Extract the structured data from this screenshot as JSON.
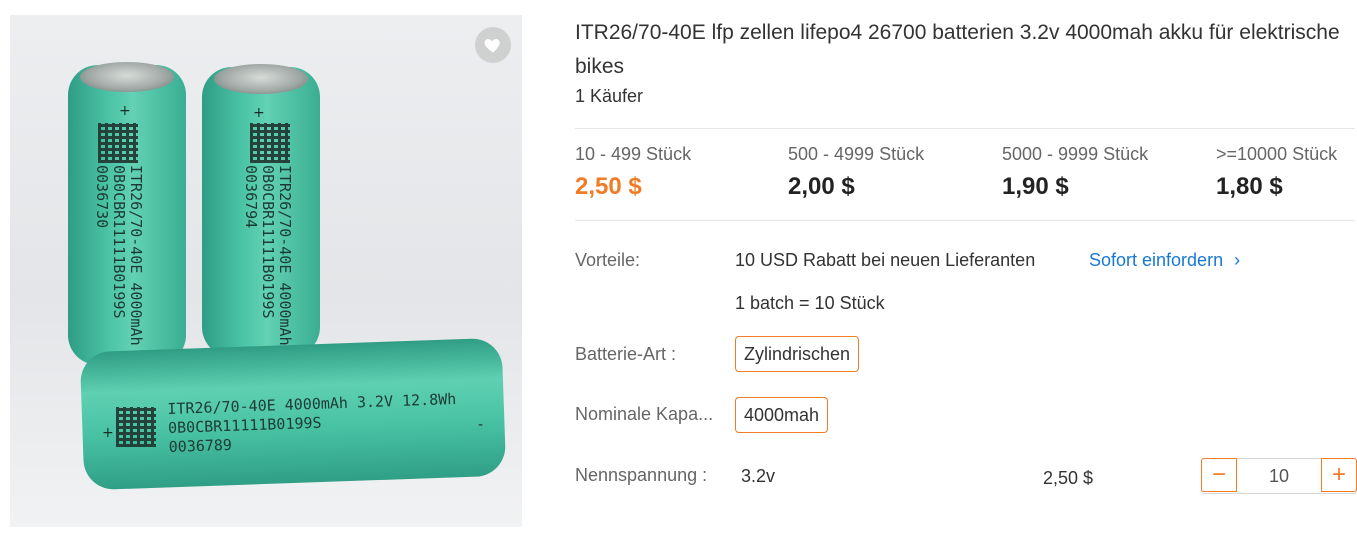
{
  "product": {
    "title": "ITR26/70-40E lfp zellen lifepo4 26700 batterien 3.2v 4000mah akku für elektrische bikes",
    "buyers": "1 Käufer"
  },
  "image": {
    "cell1_text_1": "ITR26/70-40E 4000mAh 3.",
    "cell1_text_2": "0B0CBR11111B0199S",
    "cell1_text_3": "0036730",
    "cell2_text_1": "ITR26/70-40E 4000mAh 3",
    "cell2_text_2": "0B0CBR11111B0199S",
    "cell2_text_3": "0036794",
    "cell3_text_1": "ITR26/70-40E 4000mAh 3.2V 12.8Wh",
    "cell3_text_2": "0B0CBR11111B0199S",
    "cell3_text_3": "0036789",
    "plus": "+",
    "minus": "-"
  },
  "tiers": [
    {
      "range": "10 - 499 Stück",
      "price": "2,50 $"
    },
    {
      "range": "500 - 4999 Stück",
      "price": "2,00 $"
    },
    {
      "range": "5000 - 9999 Stück",
      "price": "1,90 $"
    },
    {
      "range": ">=10000 Stück",
      "price": "1,80 $"
    }
  ],
  "benefits": {
    "label": "Vorteile:",
    "text": "10 USD Rabatt bei neuen Lieferanten",
    "link": "Sofort einfordern",
    "link_arrow": "›",
    "batch": "1 batch = 10 Stück"
  },
  "attributes": {
    "battery_type_label": "Batterie-Art :",
    "battery_type_value": "Zylindrischen",
    "capacity_label": "Nominale Kapa...",
    "capacity_value": "4000mah",
    "voltage_label": "Nennspannung :",
    "voltage_value": "3.2v",
    "voltage_price": "2,50 $"
  },
  "quantity": {
    "minus": "−",
    "value": "10",
    "plus": "+"
  },
  "colors": {
    "accent": "#f27b25",
    "link": "#1778d6"
  },
  "icons": {
    "favorite": "heart-icon"
  }
}
